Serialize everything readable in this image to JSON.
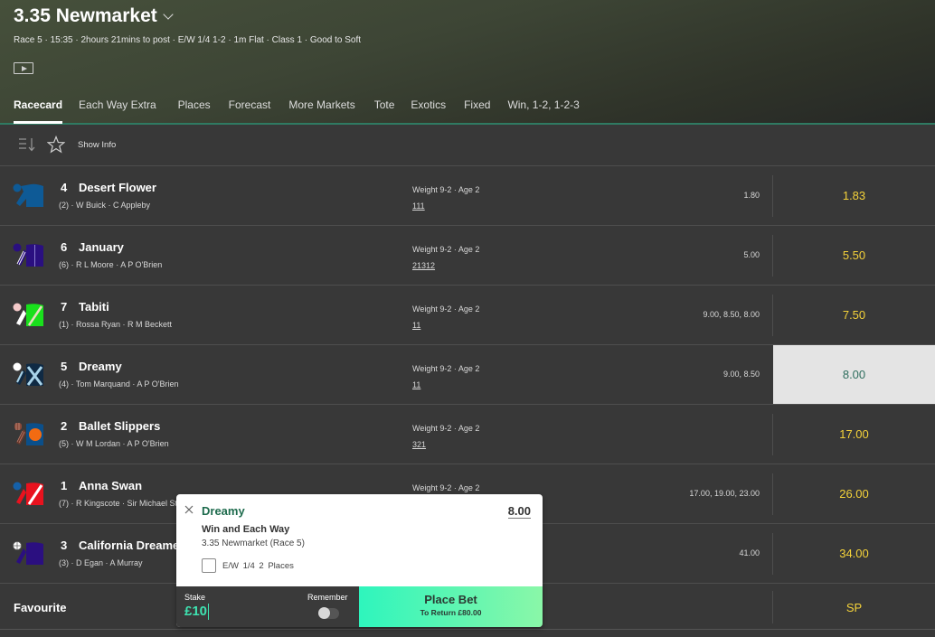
{
  "header": {
    "title": "3.35 Newmarket",
    "meta": "Race 5 · 15:35 · 2hours 21mins to post · E/W 1/4 1-2 · 1m Flat · Class 1 · Good to Soft",
    "tabs": [
      {
        "label": "Racecard",
        "active": true
      },
      {
        "label": "Each Way Extra"
      },
      {
        "label": "Places"
      },
      {
        "label": "Forecast"
      },
      {
        "label": "More Markets"
      },
      {
        "label": "Tote"
      },
      {
        "label": "Exotics"
      },
      {
        "label": "Fixed"
      },
      {
        "label": "Win, 1-2, 1-2-3"
      }
    ]
  },
  "toolbar": {
    "sort_icon": "sort-icon",
    "favourite_icon": "star-icon",
    "show_info_label": "Show Info"
  },
  "runners": [
    {
      "number": "4",
      "name": "Desert Flower",
      "draw": "(2)",
      "jockey": "W Buick",
      "trainer": "C Appleby",
      "weight_age": "Weight 9-2 · Age 2",
      "form": "111",
      "prev_odds": "1.80",
      "odds": "1.83",
      "silk_colors": [
        "#0e5a96"
      ]
    },
    {
      "number": "6",
      "name": "January",
      "draw": "(6)",
      "jockey": "R L Moore",
      "trainer": "A P O'Brien",
      "weight_age": "Weight 9-2 · Age 2",
      "form": "21312",
      "prev_odds": "5.00",
      "odds": "5.50",
      "silk_colors": [
        "#2a0f80",
        "#ffffff"
      ]
    },
    {
      "number": "7",
      "name": "Tabiti",
      "draw": "(1)",
      "jockey": "Rossa Ryan",
      "trainer": "R M Beckett",
      "weight_age": "Weight 9-2 · Age 2",
      "form": "11",
      "prev_odds": "9.00, 8.50, 8.00",
      "odds": "7.50",
      "silk_colors": [
        "#19e01c",
        "#f3c8c8",
        "#ffffff"
      ]
    },
    {
      "number": "5",
      "name": "Dreamy",
      "draw": "(4)",
      "jockey": "Tom Marquand",
      "trainer": "A P O'Brien",
      "weight_age": "Weight 9-2 · Age 2",
      "form": "11",
      "prev_odds": "9.00, 8.50",
      "odds": "8.00",
      "selected": true,
      "silk_colors": [
        "#0f2a44",
        "#a9d4ea"
      ]
    },
    {
      "number": "2",
      "name": "Ballet Slippers",
      "draw": "(5)",
      "jockey": "W M Lordan",
      "trainer": "A P O'Brien",
      "weight_age": "Weight 9-2 · Age 2",
      "form": "321",
      "prev_odds": "",
      "odds": "17.00",
      "silk_colors": [
        "#0b4f8a",
        "#f26b12"
      ]
    },
    {
      "number": "1",
      "name": "Anna Swan",
      "draw": "(7)",
      "jockey": "R Kingscote",
      "trainer": "Sir Michael Stoute",
      "weight_age": "Weight 9-2 · Age 2",
      "form": "",
      "prev_odds": "17.00, 19.00, 23.00",
      "odds": "26.00",
      "silk_colors": [
        "#e8121e",
        "#ffffff",
        "#1560a8"
      ]
    },
    {
      "number": "3",
      "name": "California Dreamer",
      "draw": "(3)",
      "jockey": "D Egan",
      "trainer": "A Murray",
      "weight_age": "",
      "form": "",
      "prev_odds": "41.00",
      "odds": "34.00",
      "silk_colors": [
        "#2b0f80",
        "#ffffff"
      ]
    }
  ],
  "favourite": {
    "label": "Favourite",
    "odds": "SP"
  },
  "betslip": {
    "selection": "Dreamy",
    "price": "8.00",
    "market": "Win and Each Way",
    "race": "3.35 Newmarket (Race 5)",
    "each_way_label": "E/W  1/4  2 Places",
    "each_way_checked": false,
    "stake_label": "Stake",
    "stake_value": "£10",
    "remember_label": "Remember",
    "remember_on": false,
    "place_bet_label": "Place Bet",
    "to_return": "To Return £80.00"
  },
  "colors": {
    "odds": "#f5d33a",
    "selected_odds_bg": "#e4e4e4",
    "selected_odds_text": "#2e6e5e",
    "brand_green": "#1e6b4d",
    "stake_accent": "#3ee3b1"
  }
}
